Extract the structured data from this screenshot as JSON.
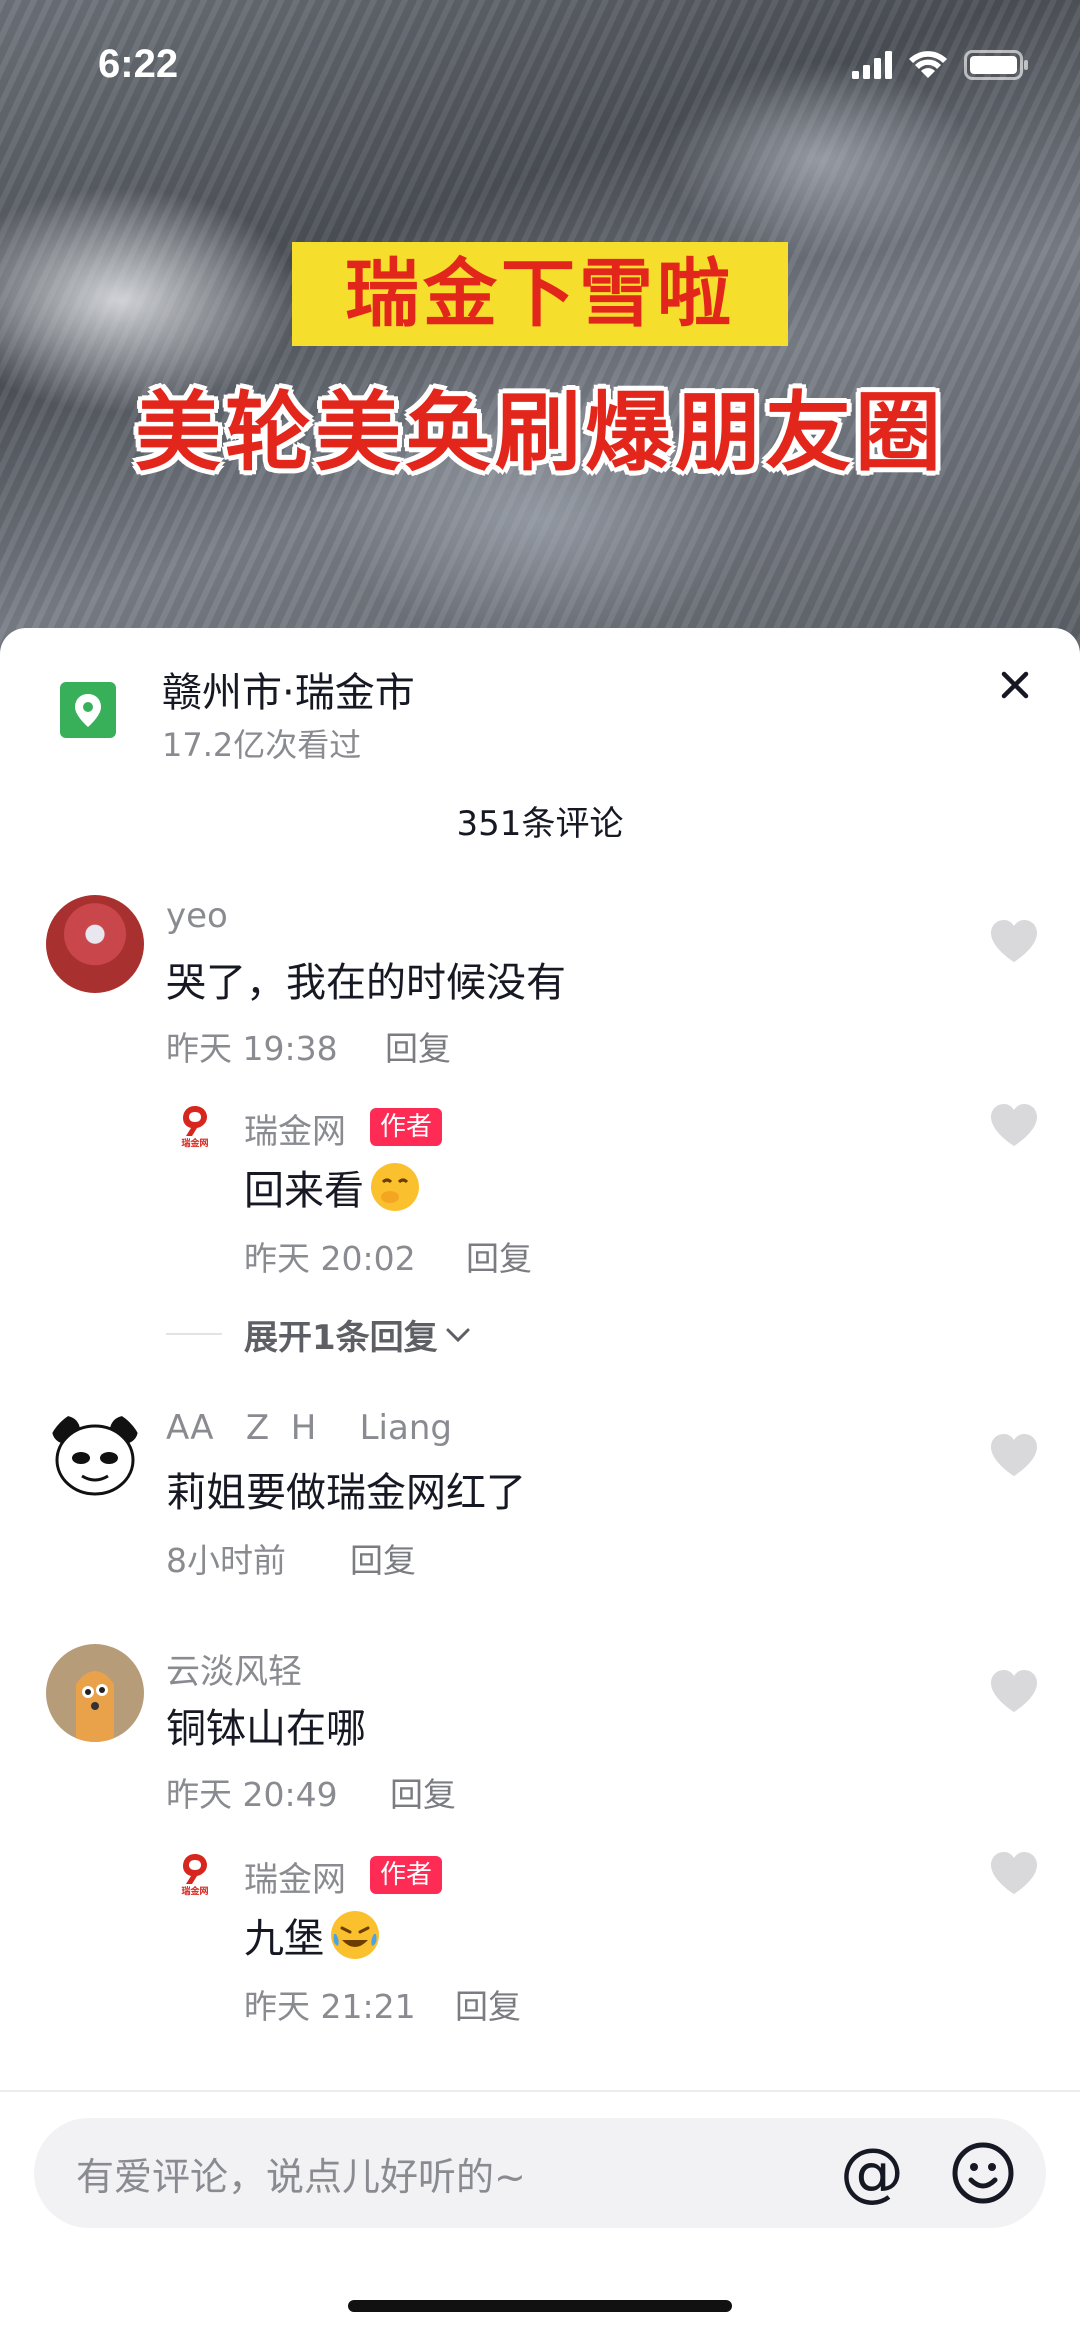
{
  "status_bar": {
    "time": "6:22"
  },
  "video": {
    "caption_line1": "瑞金下雪啦",
    "caption_line2": "美轮美奂刷爆朋友圈"
  },
  "location": {
    "title": "赣州市·瑞金市",
    "views": "17.2亿次看过"
  },
  "comments_header": "351条评论",
  "comments": [
    {
      "user": "yeo",
      "text": "哭了，我在的时候没有",
      "time": "昨天 19:38",
      "reply": "回复"
    },
    {
      "user": "瑞金网",
      "badge": "作者",
      "text": "回来看",
      "time": "昨天 20:02",
      "reply": "回复",
      "avatar_text": "瑞金网"
    },
    {
      "expand": "展开1条回复"
    },
    {
      "user": "AA   Z  H    Liang",
      "text": "莉姐要做瑞金网红了",
      "time": "8小时前",
      "reply": "回复"
    },
    {
      "user": "云淡风轻",
      "text": "铜钵山在哪",
      "time": "昨天 20:49",
      "reply": "回复"
    },
    {
      "user": "瑞金网",
      "badge": "作者",
      "text": "九堡",
      "time": "昨天 21:21",
      "reply": "回复",
      "avatar_text": "瑞金网"
    }
  ],
  "input": {
    "placeholder": "有爱评论，说点儿好听的~",
    "at_symbol": "@"
  }
}
